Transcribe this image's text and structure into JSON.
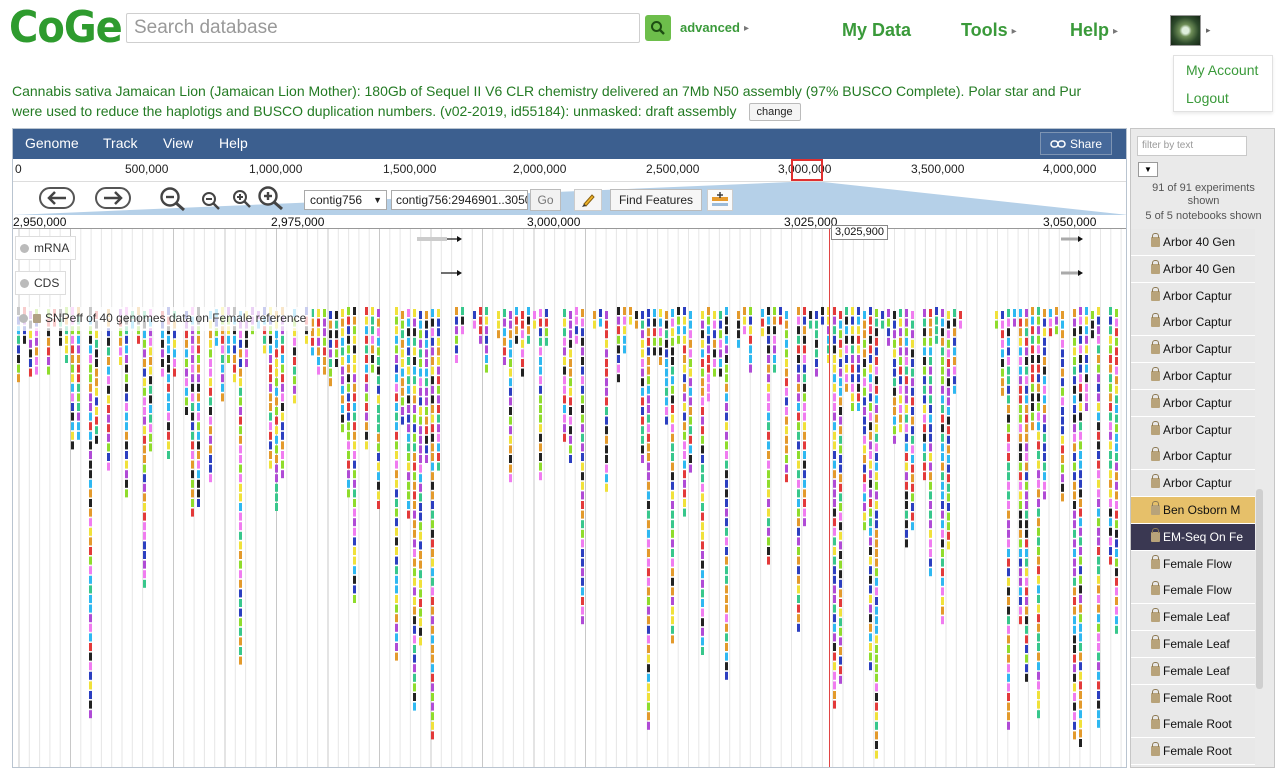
{
  "header": {
    "logo": "CoGe",
    "search_placeholder": "Search database",
    "advanced_label": "advanced",
    "nav": {
      "my_data": "My Data",
      "tools": "Tools",
      "help": "Help"
    },
    "account_menu": {
      "my_account": "My Account",
      "logout": "Logout"
    }
  },
  "description": {
    "line1": "Cannabis sativa Jamaican Lion (Jamaican Lion Mother): 180Gb of Sequel II V6 CLR chemistry delivered an 7Mb N50 assembly (97% BUSCO Complete). Polar star and Pur",
    "line2": "were used to reduce the haplotigs and BUSCO duplication numbers. (v02-2019, id55184): unmasked: draft assembly",
    "change_label": "change"
  },
  "browser": {
    "menu": {
      "genome": "Genome",
      "track": "Track",
      "view": "View",
      "help": "Help",
      "share": "Share"
    },
    "overview_ruler": [
      "0",
      "500,000",
      "1,000,000",
      "1,500,000",
      "2,000,000",
      "2,500,000",
      "3,000,000",
      "3,500,000",
      "4,000,000"
    ],
    "sequence_select": "contig756",
    "location": "contig756:2946901..3050",
    "go_label": "Go",
    "find_features_label": "Find Features",
    "detail_ruler": [
      "2,950,000",
      "2,975,000",
      "3,000,000",
      "3,025,000",
      "3,050,000"
    ],
    "position_flag": "3,025,900",
    "tracks": {
      "mrna": "mRNA",
      "cds": "CDS",
      "snpeff": "SNPeff of 40 genomes data on Female reference"
    },
    "colors": {
      "variants": [
        "#2fb8f1",
        "#b04bd6",
        "#8fdc2c",
        "#f07cf0",
        "#222222",
        "#2c3fc0",
        "#e33a3a",
        "#e39a2c",
        "#38c78c",
        "#f0e13a"
      ],
      "menubar": "#3c5f8f",
      "brand_green": "#2e9b2e"
    }
  },
  "sidebar": {
    "filter_placeholder": "filter by text",
    "experiments_line1": "91 of 91 experiments",
    "experiments_line2": "shown",
    "notebooks": "5 of 5 notebooks shown",
    "items": [
      "Arbor 40 Gen",
      "Arbor 40 Gen",
      "Arbor Captur",
      "Arbor Captur",
      "Arbor Captur",
      "Arbor Captur",
      "Arbor Captur",
      "Arbor Captur",
      "Arbor Captur",
      "Arbor Captur",
      "Ben Osborn M",
      "EM-Seq On Fe",
      "Female Flow",
      "Female Flow",
      "Female Leaf",
      "Female Leaf",
      "Female Leaf",
      "Female Root",
      "Female Root",
      "Female Root"
    ]
  }
}
